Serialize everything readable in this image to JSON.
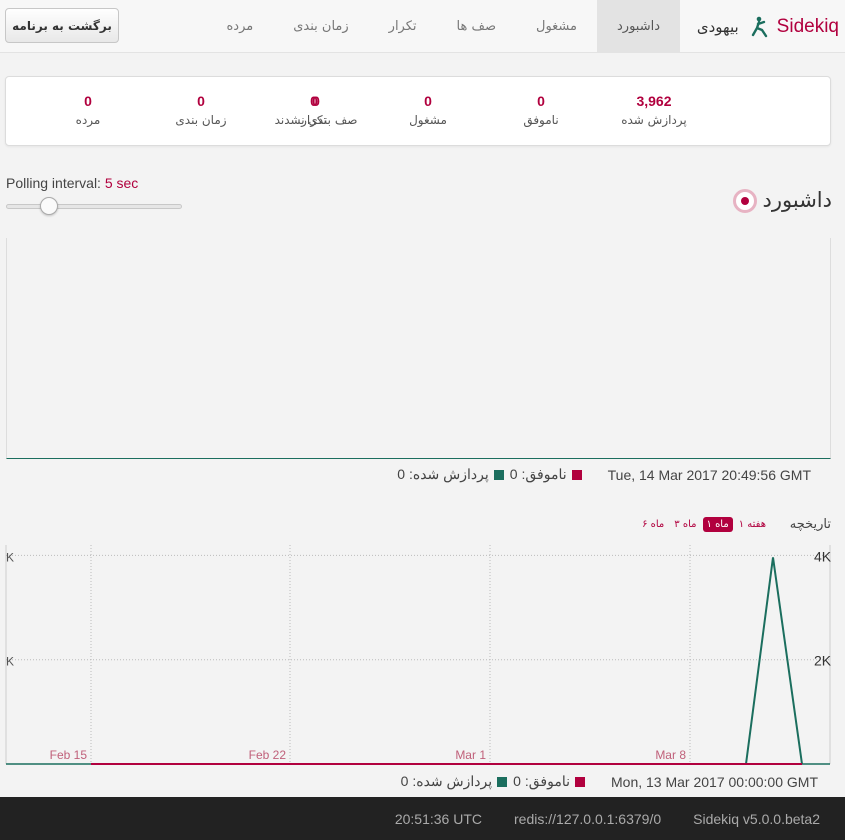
{
  "navbar": {
    "back_button": "برگشت به برنامه",
    "brand": "Sidekiq",
    "locale": "بیهودی",
    "tabs": [
      "داشبورد",
      "مشغول",
      "صف ها",
      "تکرار",
      "زمان بندی",
      "مرده"
    ]
  },
  "stats": [
    {
      "value": "3,962",
      "label": "پردازش شده"
    },
    {
      "value": "0",
      "label": "ناموفق"
    },
    {
      "value": "0",
      "label": "مشغول"
    },
    {
      "value": "0",
      "label": "صف بندی نشدند"
    },
    {
      "value": "0",
      "label": "تکرار"
    },
    {
      "value": "0",
      "label": "زمان بندی"
    },
    {
      "value": "0",
      "label": "مرده"
    }
  ],
  "polling": {
    "label": "Polling interval:",
    "value": "5 sec",
    "level": 0.2
  },
  "dashboard": {
    "title": "داشبورد"
  },
  "realtime": {
    "timestamp": "Tue, 14 Mar 2017 20:49:56 GMT",
    "failed_label": "ناموفق: 0",
    "processed_label": "پردازش شده: 0"
  },
  "history": {
    "title": "تاریخچه",
    "ranges": [
      "۱ هفته",
      "۱ ماه",
      "۳ ماه",
      "۶ ماه"
    ],
    "active_range": 1,
    "timestamp": "Mon, 13 Mar 2017 00:00:00 GMT",
    "failed_label": "ناموفق: 0",
    "processed_label": "پردازش شده: 0"
  },
  "colors": {
    "accent": "#b1003e",
    "processed": "#1b6e5e",
    "failed": "#b1003e"
  },
  "chart_data": {
    "type": "line",
    "x": [
      "Feb 15",
      "Feb 22",
      "Mar 1",
      "Mar 8",
      "Mar 10",
      "Mar 11",
      "Mar 12",
      "Mar 13"
    ],
    "x_ticks": [
      "Feb 15",
      "Feb 22",
      "Mar 1",
      "Mar 8"
    ],
    "y_ticks": [
      "2K",
      "4K"
    ],
    "ylim": [
      0,
      4200
    ],
    "series": [
      {
        "name": "",
        "color": "#1b6e5e",
        "values": [
          0,
          0,
          0,
          0,
          0,
          0,
          3962,
          0
        ]
      },
      {
        "name": "",
        "color": "#b1003e",
        "values": [
          0,
          0,
          0,
          0,
          0,
          0,
          0,
          0
        ]
      }
    ],
    "grid": true
  },
  "footer": {
    "time": "20:51:36 UTC",
    "redis": "redis://127.0.0.1:6379/0",
    "version": "Sidekiq v5.0.0.beta2"
  }
}
